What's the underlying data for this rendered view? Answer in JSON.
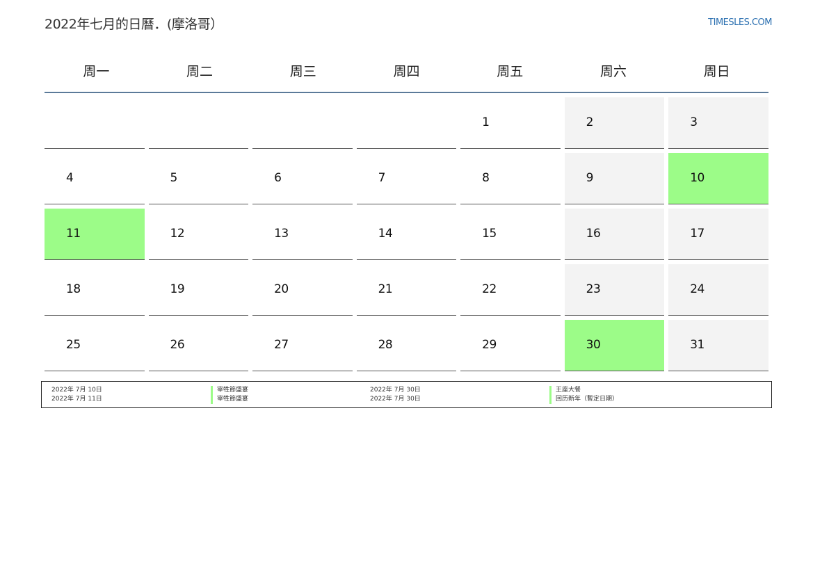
{
  "header": {
    "title": "2022年七月的日曆．(摩洛哥）",
    "site": "TIMESLES.COM"
  },
  "colors": {
    "holiday": "#9cfc88",
    "weekend": "#f3f3f3",
    "accent": "#5b7a99",
    "link": "#2a6fb0"
  },
  "weekdays": [
    "周一",
    "周二",
    "周三",
    "周四",
    "周五",
    "周六",
    "周日"
  ],
  "weeks": [
    [
      {
        "d": ""
      },
      {
        "d": ""
      },
      {
        "d": ""
      },
      {
        "d": ""
      },
      {
        "d": "1"
      },
      {
        "d": "2",
        "t": "weekend"
      },
      {
        "d": "3",
        "t": "weekend"
      }
    ],
    [
      {
        "d": "4"
      },
      {
        "d": "5"
      },
      {
        "d": "6"
      },
      {
        "d": "7"
      },
      {
        "d": "8"
      },
      {
        "d": "9",
        "t": "weekend"
      },
      {
        "d": "10",
        "t": "holiday"
      }
    ],
    [
      {
        "d": "11",
        "t": "holiday"
      },
      {
        "d": "12"
      },
      {
        "d": "13"
      },
      {
        "d": "14"
      },
      {
        "d": "15"
      },
      {
        "d": "16",
        "t": "weekend"
      },
      {
        "d": "17",
        "t": "weekend"
      }
    ],
    [
      {
        "d": "18"
      },
      {
        "d": "19"
      },
      {
        "d": "20"
      },
      {
        "d": "21"
      },
      {
        "d": "22"
      },
      {
        "d": "23",
        "t": "weekend"
      },
      {
        "d": "24",
        "t": "weekend"
      }
    ],
    [
      {
        "d": "25"
      },
      {
        "d": "26"
      },
      {
        "d": "27"
      },
      {
        "d": "28"
      },
      {
        "d": "29"
      },
      {
        "d": "30",
        "t": "holiday"
      },
      {
        "d": "31",
        "t": "weekend"
      }
    ]
  ],
  "legend": {
    "dates_a": [
      "2022年 7月 10日",
      "2022年 7月 11日"
    ],
    "names_a": [
      "宰牲節盛宴",
      "宰牲節盛宴"
    ],
    "dates_b": [
      "2022年 7月 30日",
      "2022年 7月 30日"
    ],
    "names_b": [
      "王座大餐",
      "回历新年（暫定日期）"
    ]
  }
}
